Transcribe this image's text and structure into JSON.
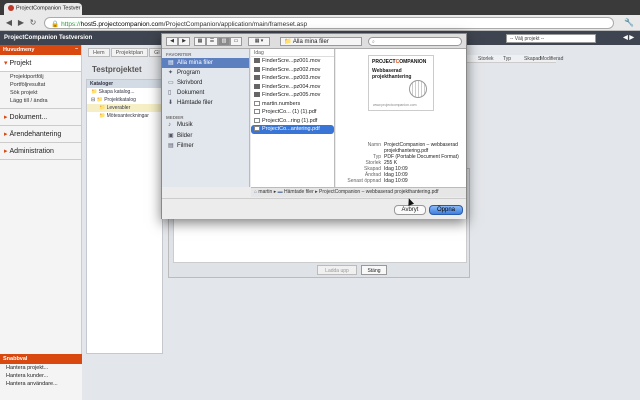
{
  "browser": {
    "tab_title": "ProjectCompanion Testver",
    "url_scheme": "https://",
    "url_host": "host5.projectcompanion.com",
    "url_path": "/ProjectCompanion/application/main/frameset.asp"
  },
  "app": {
    "header_title": "ProjectCompanion Testversion",
    "project_select": "-- Välj projekt --",
    "sidebar": {
      "head": "Huvudmeny",
      "minimize": "–",
      "projekt": "Projekt",
      "sub_items": [
        "Projektportfölj",
        "Portföljresultat",
        "Sök projekt",
        "Lägg till / ändra"
      ],
      "dokument": "Dokument...",
      "arende": "Ärendehantering",
      "admin": "Administration"
    },
    "quick": {
      "head": "Snabbval",
      "items": [
        "Hantera projekt...",
        "Hantera kunder...",
        "Hantera användare..."
      ]
    },
    "tabs": [
      "Hem",
      "Projektplan",
      "Gl"
    ],
    "title": "Testprojektet",
    "catalog": {
      "head": "Kataloger",
      "rows": [
        "Skapa katalog...",
        "Projektkatalog",
        "Leverabler",
        "Mötesanteckningar"
      ]
    },
    "table_cols": [
      "Storlek",
      "Typ",
      "Skapad",
      "Modifierad"
    ],
    "upload": {
      "btn_add": "Ladda upp",
      "btn_close": "Stäng"
    }
  },
  "dialog": {
    "location": "Alla mina filer",
    "search_placeholder": "",
    "sidebar": {
      "favorites_label": "FAVORITER",
      "favorites": [
        "Alla mina filer",
        "Program",
        "Skrivbord",
        "Dokument",
        "Hämtade filer"
      ],
      "media_label": "MEDIER",
      "media": [
        "Musik",
        "Bilder",
        "Filmer"
      ]
    },
    "column_header": "Idag",
    "files": [
      "FinderScre...pz001.mov",
      "FinderScre...pz002.mov",
      "FinderScre...pz003.mov",
      "FinderScre...pz004.mov",
      "FinderScre...pz005.mov",
      "martin.numbers",
      "ProjectCo... (1) (1).pdf",
      "ProjectCo...ring (1).pdf",
      "ProjectCo...antering.pdf"
    ],
    "preview": {
      "logo_a": "PROJECT",
      "logo_b": "C",
      "logo_c": "OMPANION",
      "thumb_title": "Webbaserad projekthantering",
      "thumb_url": "www.projectcompanion.com",
      "meta": [
        {
          "k": "Namn",
          "v": "ProjectCompanion – webbaserad projekthantering.pdf"
        },
        {
          "k": "Typ",
          "v": "PDF (Portable Document Format)"
        },
        {
          "k": "Storlek",
          "v": "255 K"
        },
        {
          "k": "Skapad",
          "v": "Idag 10:09"
        },
        {
          "k": "Ändrad",
          "v": "Idag 10:09"
        },
        {
          "k": "Senast öppnad",
          "v": "Idag 10:09"
        }
      ]
    },
    "path": [
      "martin",
      "Hämtade filer",
      "ProjectCompanion – webbaserad projekthantering.pdf"
    ],
    "cancel": "Avbryt",
    "open": "Öppna"
  }
}
